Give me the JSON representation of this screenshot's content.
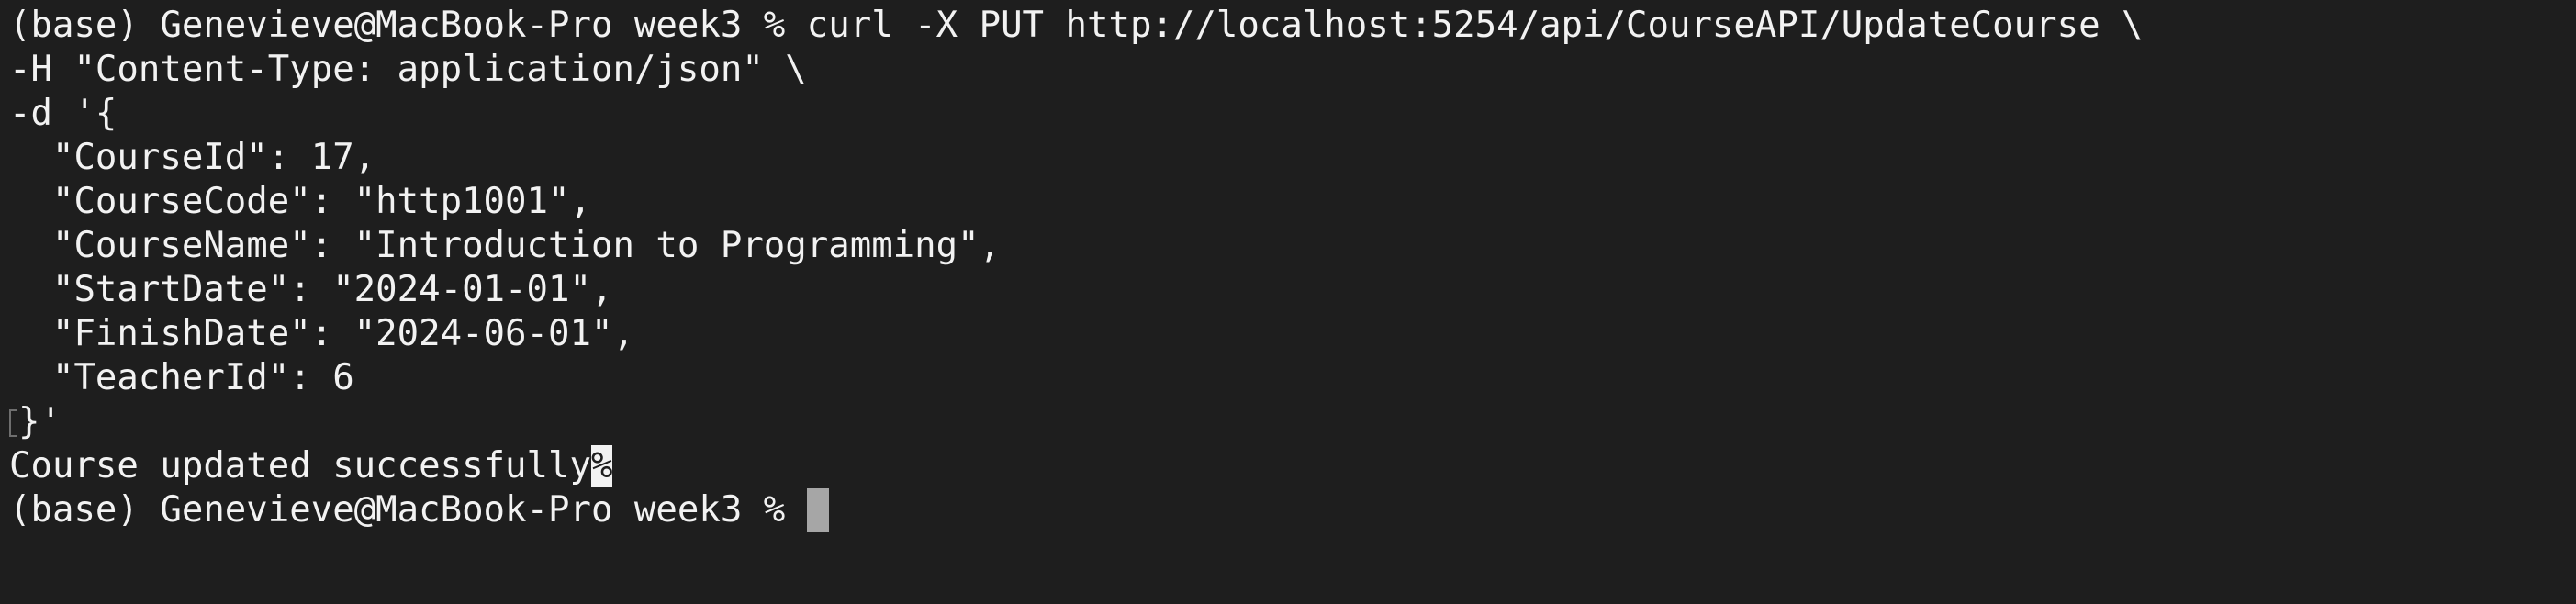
{
  "terminal": {
    "lines": [
      "(base) Genevieve@MacBook-Pro week3 % curl -X PUT http://localhost:5254/api/CourseAPI/UpdateCourse \\",
      "-H \"Content-Type: application/json\" \\",
      "-d '{",
      "  \"CourseId\": 17,",
      "  \"CourseCode\": \"http1001\",",
      "  \"CourseName\": \"Introduction to Programming\",",
      "  \"StartDate\": \"2024-01-01\",",
      "  \"FinishDate\": \"2024-06-01\",",
      "  \"TeacherId\": 6"
    ],
    "closing_line": "}'",
    "output_text": "Course updated successfully",
    "no_newline_mark": "%",
    "prompt": "(base) Genevieve@MacBook-Pro week3 % "
  },
  "colors": {
    "background": "#1e1e1e",
    "text": "#f2f2f2",
    "cursor": "#a6a6a6"
  }
}
